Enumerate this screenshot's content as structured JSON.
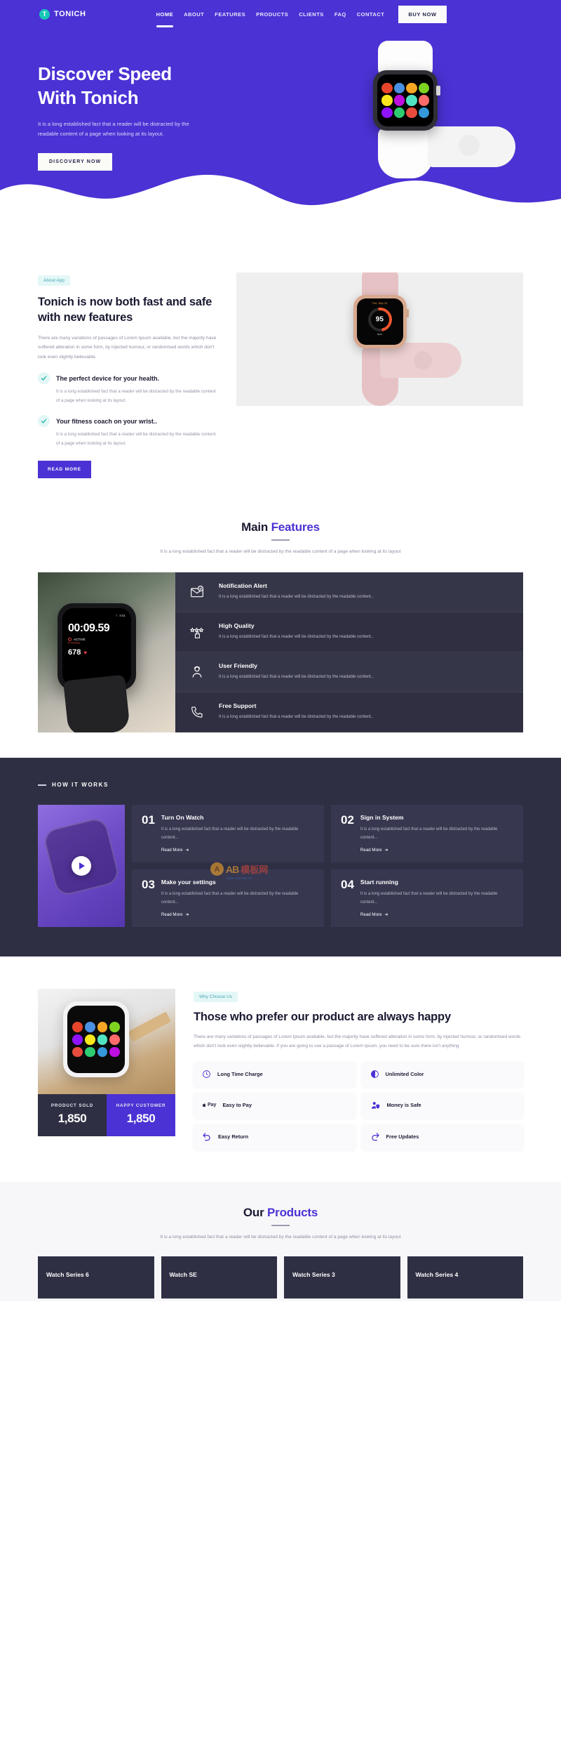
{
  "nav": {
    "brand_initial": "T",
    "brand_name": "TONICH",
    "links": [
      "HOME",
      "ABOUT",
      "FEATURES",
      "PRODUCTS",
      "CLIENTS",
      "FAQ",
      "CONTACT"
    ],
    "cta": "BUY NOW"
  },
  "hero": {
    "title_line1": "Discover Speed",
    "title_line2": "With Tonich",
    "desc": "It is a long established fact that a reader will be distracted by the readable content of a page when looking at its layout.",
    "button": "DISCOVERY NOW"
  },
  "about": {
    "tag": "About App",
    "title": "Tonich is now both fast and safe with new features",
    "desc": "There are many variations of passages of Lorem Ipsum available, but the majority have suffered alteration in some form, by injected humour, or randomised words which don't look even slightly believable.",
    "checks": [
      {
        "title": "The perfect device for your health.",
        "desc": "It is a long established fact that a reader will be distracted by the readable content of a page when looking at its layout."
      },
      {
        "title": "Your fitness coach on your wrist..",
        "desc": "It is a long established fact that a reader will be distracted by the readable content of a page when looking at its layout."
      }
    ],
    "button": "READ MORE",
    "watch_date": "Tue, Sep 12",
    "watch_value": "95",
    "watch_unit": "bpm"
  },
  "features": {
    "title_plain": "Main ",
    "title_accent": "Features",
    "desc": "It is a long established fact that a reader will be distracted by the readable content of a page when looking at its layout",
    "photo": {
      "time": "4:51",
      "timer": "00:09.59",
      "active_label": "ACTIVE",
      "kcal": "TOTAL",
      "kcal_value": "0",
      "bpm": "678"
    },
    "cards": [
      {
        "icon": "mail-check-icon",
        "title": "Notification Alert",
        "desc": "It is a long established fact that a reader will be distracted by the readable content.."
      },
      {
        "icon": "star-rating-click-icon",
        "title": "High Quality",
        "desc": "It is a long established fact that a reader will be distracted by the readable content.."
      },
      {
        "icon": "user-support-icon",
        "title": "User Friendly",
        "desc": "It is a long established fact that a reader will be distracted by the readable content.."
      },
      {
        "icon": "phone-icon",
        "title": "Free Support",
        "desc": "It is a long established fact that a reader will be distracted by the readable content.."
      }
    ]
  },
  "watermark": {
    "letter": "A",
    "ab": "AB",
    "cn": "模板网",
    "url": "www.Admin5.cn"
  },
  "how": {
    "label": "HOW IT WORKS",
    "cards": [
      {
        "num": "01",
        "title": "Turn On Watch",
        "desc": "It is a long established fact that a reader will be distracted by the readable content...",
        "more": "Read More"
      },
      {
        "num": "02",
        "title": "Sign in System",
        "desc": "It is a long established fact that a reader will be distracted by the readable content...",
        "more": "Read More"
      },
      {
        "num": "03",
        "title": "Make your settings",
        "desc": "It is a long established fact that a reader will be distracted by the readable content...",
        "more": "Read More"
      },
      {
        "num": "04",
        "title": "Start running",
        "desc": "It is a long established fact that a reader will be distracted by the readable content...",
        "more": "Read More"
      }
    ]
  },
  "why": {
    "tag": "Why Choose Us",
    "title": "Those who prefer our product are always happy",
    "desc": "There are many variations of passages of Lorem Ipsum available, but the majority have suffered alteration in some form, by injected humour, or randomised words which don't look even slightly believable. If you are going to use a passage of Lorem Ipsum, you need to be sure there isn't anything",
    "stats": [
      {
        "label": "PRODUCT SOLD",
        "value": "1,850"
      },
      {
        "label": "HAPPY CUSTOMER",
        "value": "1,850"
      }
    ],
    "items": [
      {
        "icon": "clock-icon",
        "label": "Long Time Charge"
      },
      {
        "icon": "contrast-circle-icon",
        "label": "Unlimited Color"
      },
      {
        "icon": "apple-pay-icon",
        "label": "Easy to Pay"
      },
      {
        "icon": "user-shield-icon",
        "label": "Money is Safe"
      },
      {
        "icon": "undo-arrow-icon",
        "label": "Easy Return"
      },
      {
        "icon": "refresh-arrow-icon",
        "label": "Free Updates"
      }
    ]
  },
  "products": {
    "title_plain": "Our ",
    "title_accent": "Products",
    "desc": "It is a long established fact that a reader will be distracted by the readable content of a page when looking at its layout",
    "cards": [
      "Watch Series 6",
      "Watch SE",
      "Watch Series 3",
      "Watch Series 4"
    ]
  },
  "colors": {
    "accent": "#4a32d4",
    "dark": "#2f2f44",
    "teal": "#17c7b6"
  }
}
